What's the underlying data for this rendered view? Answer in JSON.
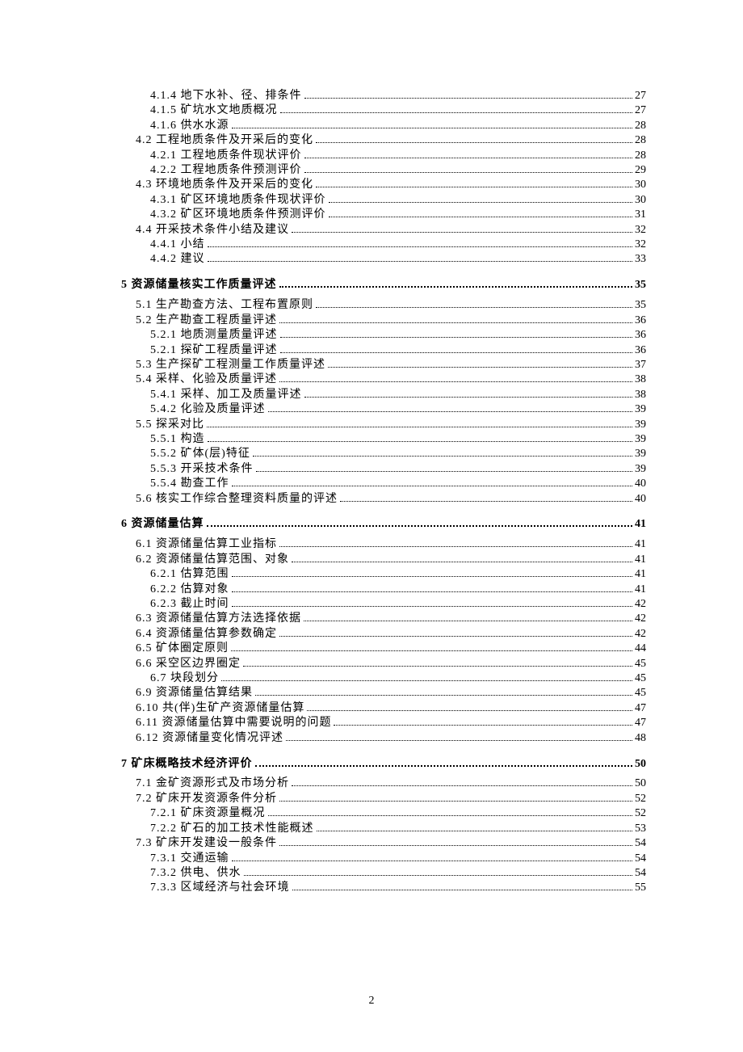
{
  "page_number": "2",
  "toc": [
    {
      "level": 3,
      "label": "4.1.4 地下水补、径、排条件",
      "page": "27"
    },
    {
      "level": 3,
      "label": "4.1.5 矿坑水文地质概况",
      "page": "27"
    },
    {
      "level": 3,
      "label": "4.1.6 供水水源",
      "page": "28"
    },
    {
      "level": 2,
      "label": "4.2 工程地质条件及开采后的变化",
      "page": "28"
    },
    {
      "level": 3,
      "label": "4.2.1 工程地质条件现状评价",
      "page": "28"
    },
    {
      "level": 3,
      "label": "4.2.2 工程地质条件预测评价",
      "page": "29"
    },
    {
      "level": 2,
      "label": "4.3 环境地质条件及开采后的变化",
      "page": "30"
    },
    {
      "level": 3,
      "label": "4.3.1 矿区环境地质条件现状评价",
      "page": "30"
    },
    {
      "level": 3,
      "label": "4.3.2 矿区环境地质条件预测评价",
      "page": "31"
    },
    {
      "level": 2,
      "label": "4.4 开采技术条件小结及建议",
      "page": "32"
    },
    {
      "level": 3,
      "label": "4.4.1 小结",
      "page": "32"
    },
    {
      "level": 3,
      "label": "4.4.2 建议",
      "page": "33"
    },
    {
      "level": 1,
      "label": "5 资源储量核实工作质量评述",
      "page": "35"
    },
    {
      "level": 2,
      "label": "5.1 生产勘查方法、工程布置原则",
      "page": "35"
    },
    {
      "level": 2,
      "label": "5.2 生产勘查工程质量评述",
      "page": "36"
    },
    {
      "level": 3,
      "label": "5.2.1 地质测量质量评述",
      "page": "36"
    },
    {
      "level": 3,
      "label": "5.2.1 探矿工程质量评述",
      "page": "36"
    },
    {
      "level": 2,
      "label": "5.3 生产探矿工程测量工作质量评述",
      "page": "37"
    },
    {
      "level": 2,
      "label": "5.4 采样、化验及质量评述",
      "page": "38"
    },
    {
      "level": 3,
      "label": "5.4.1 采样、加工及质量评述",
      "page": "38"
    },
    {
      "level": 3,
      "label": "5.4.2 化验及质量评述",
      "page": "39"
    },
    {
      "level": 2,
      "label": "5.5 探采对比",
      "page": "39"
    },
    {
      "level": 3,
      "label": "5.5.1 构造",
      "page": "39"
    },
    {
      "level": 3,
      "label": "5.5.2 矿体(层)特征",
      "page": "39"
    },
    {
      "level": 3,
      "label": "5.5.3 开采技术条件",
      "page": "39"
    },
    {
      "level": 3,
      "label": "5.5.4 勘查工作",
      "page": "40"
    },
    {
      "level": 2,
      "label": "5.6 核实工作综合整理资料质量的评述",
      "page": "40"
    },
    {
      "level": 1,
      "label": "6 资源储量估算",
      "page": "41"
    },
    {
      "level": 2,
      "label": "6.1 资源储量估算工业指标",
      "page": "41"
    },
    {
      "level": 2,
      "label": "6.2 资源储量估算范围、对象",
      "page": "41"
    },
    {
      "level": 3,
      "label": "6.2.1 估算范围",
      "page": "41"
    },
    {
      "level": 3,
      "label": "6.2.2 估算对象",
      "page": "41"
    },
    {
      "level": 3,
      "label": "6.2.3 截止时间",
      "page": "42"
    },
    {
      "level": 2,
      "label": "6.3 资源储量估算方法选择依据",
      "page": "42"
    },
    {
      "level": 2,
      "label": "6.4 资源储量估算参数确定",
      "page": "42"
    },
    {
      "level": 2,
      "label": "6.5 矿体圈定原则",
      "page": "44"
    },
    {
      "level": 2,
      "label": "6.6 采空区边界圈定",
      "page": "45"
    },
    {
      "level": 3,
      "label": "6.7 块段划分",
      "page": "45"
    },
    {
      "level": 2,
      "label": "6.9 资源储量估算结果",
      "page": "45"
    },
    {
      "level": 2,
      "label": "6.10 共(伴)生矿产资源储量估算",
      "page": "47"
    },
    {
      "level": 2,
      "label": "6.11 资源储量估算中需要说明的问题",
      "page": "47"
    },
    {
      "level": 2,
      "label": "6.12 资源储量变化情况评述",
      "page": "48"
    },
    {
      "level": 1,
      "label": "7 矿床概略技术经济评价",
      "page": "50"
    },
    {
      "level": 2,
      "label": "7.1 金矿资源形式及市场分析",
      "page": "50"
    },
    {
      "level": 2,
      "label": "7.2 矿床开发资源条件分析",
      "page": "52"
    },
    {
      "level": 3,
      "label": "7.2.1 矿床资源量概况",
      "page": "52"
    },
    {
      "level": 3,
      "label": "7.2.2 矿石的加工技术性能概述",
      "page": "53"
    },
    {
      "level": 2,
      "label": "7.3 矿床开发建设一般条件",
      "page": "54"
    },
    {
      "level": 3,
      "label": "7.3.1 交通运输",
      "page": "54"
    },
    {
      "level": 3,
      "label": "7.3.2 供电、供水",
      "page": "54"
    },
    {
      "level": 3,
      "label": "7.3.3 区域经济与社会环境",
      "page": "55"
    }
  ]
}
